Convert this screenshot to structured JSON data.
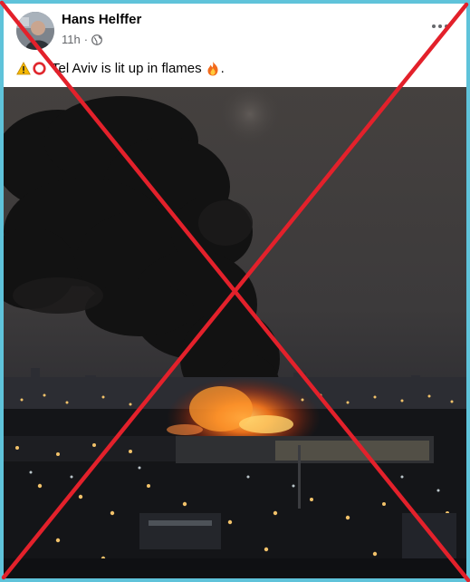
{
  "post": {
    "author_name": "Hans Helffer",
    "time_ago": "11h",
    "separator": "·",
    "privacy_icon": "globe-icon",
    "more_icon": "more-options-icon",
    "text": "Tel Aviv is lit up in flames",
    "text_suffix": ".",
    "leading_emojis": [
      "warning-icon",
      "red-circle-icon"
    ],
    "trailing_emoji": "fire-icon"
  },
  "photo": {
    "description_icon": "city-fire-photo"
  },
  "overlay": {
    "icon": "red-x-cross",
    "color": "#e3212b"
  },
  "colors": {
    "frame": "#5fc3da",
    "name": "#050505",
    "meta": "#65676b"
  }
}
